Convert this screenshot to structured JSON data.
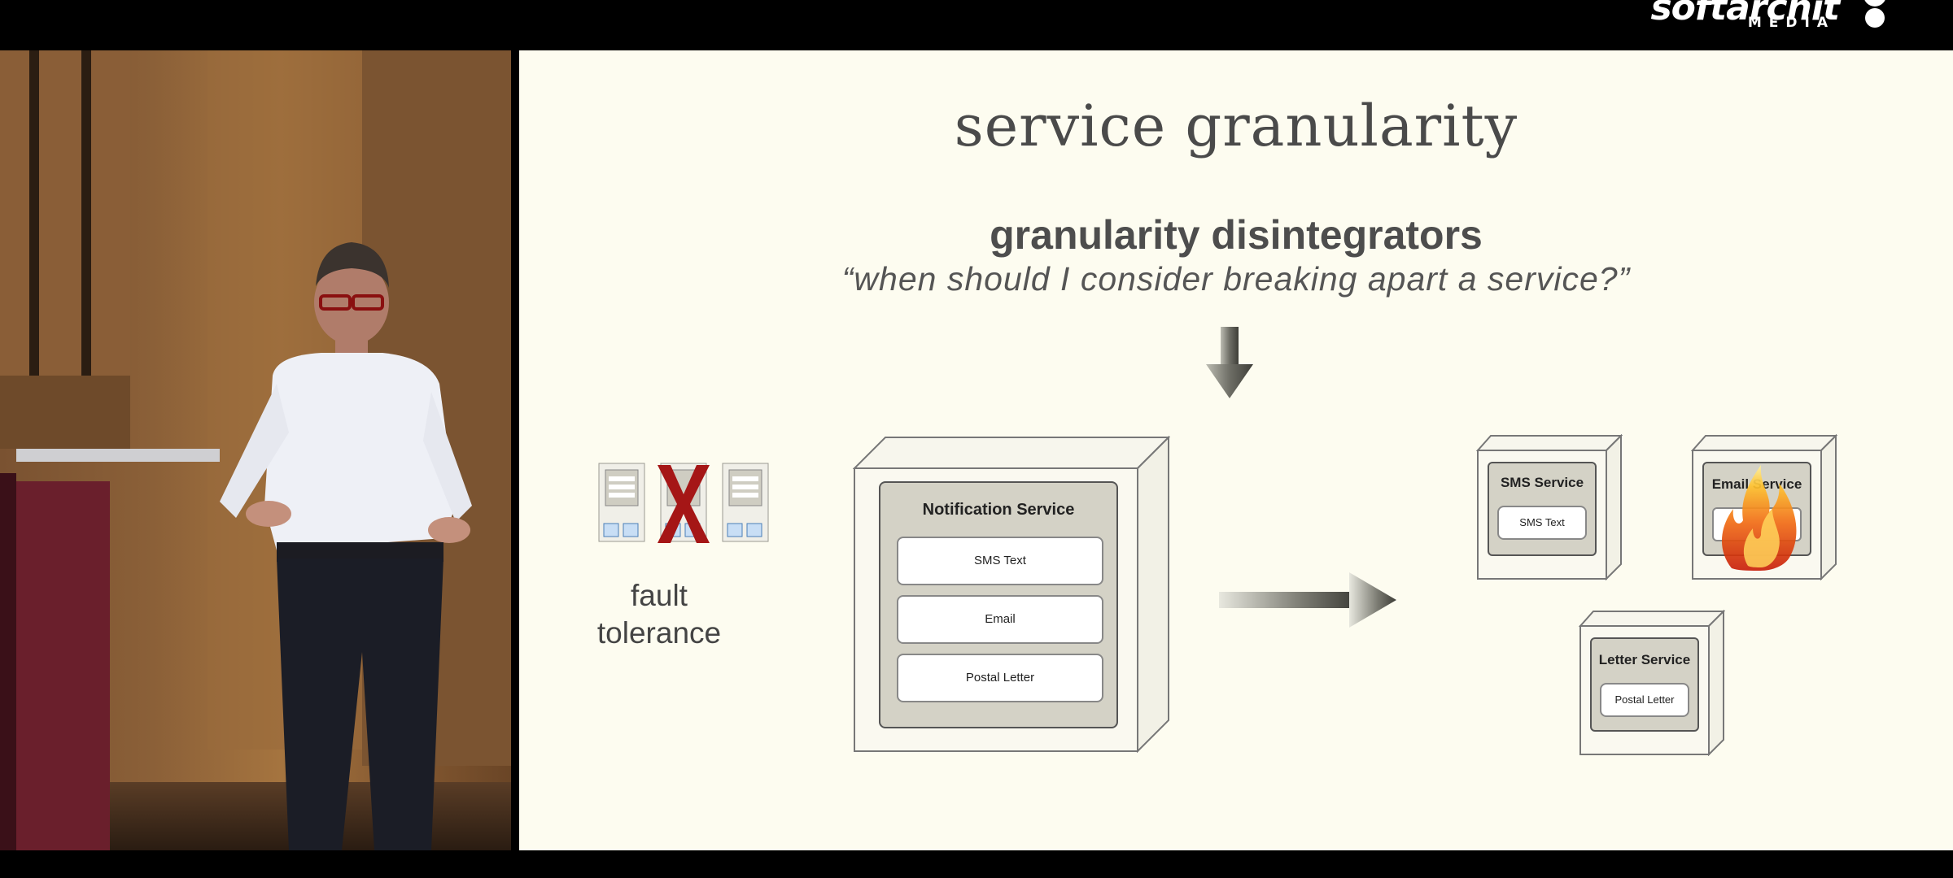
{
  "logo": {
    "word": "softarchit",
    "sub": "MEDIA"
  },
  "slide": {
    "title": "service granularity",
    "subtitle": "granularity disintegrators",
    "question": "“when should I consider breaking apart a service?”",
    "fault_label_line1": "fault",
    "fault_label_line2": "tolerance",
    "notification": {
      "title": "Notification Service",
      "items": [
        "SMS Text",
        "Email",
        "Postal Letter"
      ]
    },
    "sms_service": {
      "title": "SMS Service",
      "item": "SMS Text"
    },
    "email_service": {
      "title": "Email Service"
    },
    "letter_service": {
      "title": "Letter Service",
      "item": "Postal Letter"
    }
  },
  "colors": {
    "slide_bg": "#fdfcf0",
    "box_fill": "#d4d2c6",
    "cross": "#b01616"
  }
}
